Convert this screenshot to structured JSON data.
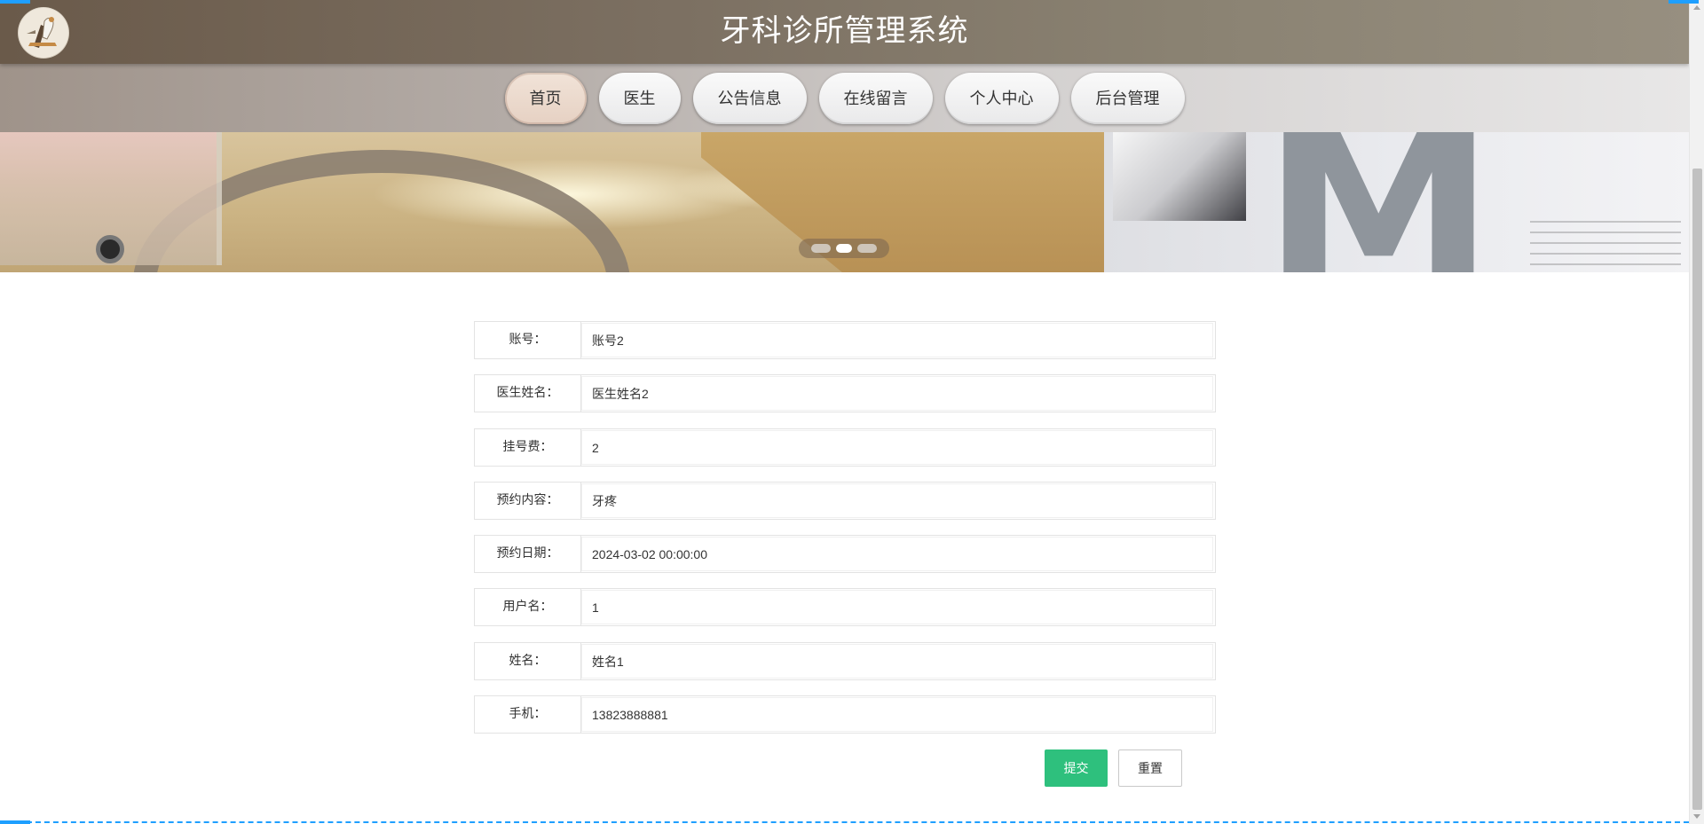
{
  "header": {
    "site_title": "牙科诊所管理系统",
    "logo_icon": "dentist-logo-icon"
  },
  "nav": {
    "items": [
      {
        "label": "首页",
        "active": true
      },
      {
        "label": "医生",
        "active": false
      },
      {
        "label": "公告信息",
        "active": false
      },
      {
        "label": "在线留言",
        "active": false
      },
      {
        "label": "个人中心",
        "active": false
      },
      {
        "label": "后台管理",
        "active": false
      }
    ]
  },
  "carousel": {
    "slide_count": 3,
    "active_index": 1
  },
  "form": {
    "fields": [
      {
        "label": "账号：",
        "value": "账号2"
      },
      {
        "label": "医生姓名：",
        "value": "医生姓名2"
      },
      {
        "label": "挂号费：",
        "value": "2"
      },
      {
        "label": "预约内容：",
        "value": "牙疼"
      },
      {
        "label": "预约日期：",
        "value": "2024-03-02 00:00:00"
      },
      {
        "label": "用户名：",
        "value": "1"
      },
      {
        "label": "姓名：",
        "value": "姓名1"
      },
      {
        "label": "手机：",
        "value": "13823888881"
      }
    ],
    "submit_label": "提交",
    "reset_label": "重置"
  },
  "colors": {
    "accent_green": "#2ec07d",
    "accent_blue": "#1e9fff",
    "header_brown": "#7c7062"
  }
}
